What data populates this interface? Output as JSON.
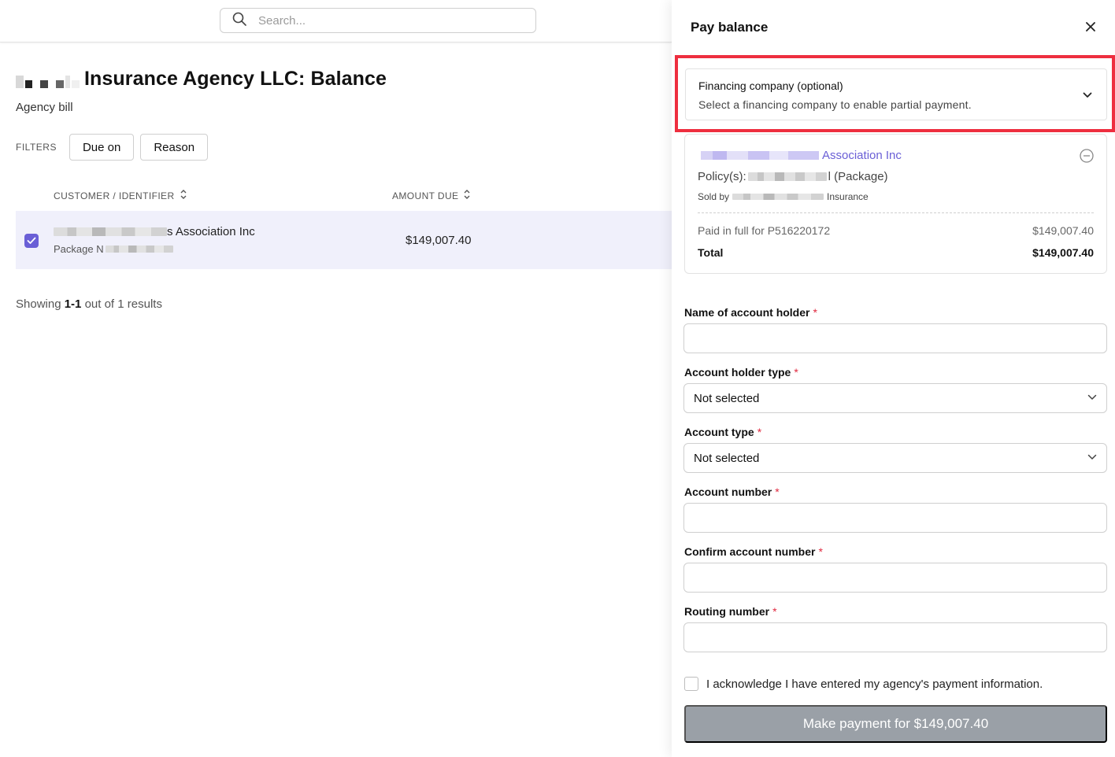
{
  "search": {
    "placeholder": "Search..."
  },
  "page": {
    "title": "Insurance Agency LLC: Balance",
    "subtitle": "Agency bill"
  },
  "filters": {
    "label": "FILTERS",
    "buttons": [
      "Due on",
      "Reason"
    ]
  },
  "table": {
    "columns": [
      "CUSTOMER / IDENTIFIER",
      "AMOUNT DUE"
    ],
    "rows": [
      {
        "customer_suffix": "s Association Inc",
        "identifier_prefix": "Package N",
        "amount": "$149,007.40",
        "selected": true
      }
    ]
  },
  "pagination": {
    "prefix": "Showing ",
    "range": "1-1",
    "suffix": " out of 1 results"
  },
  "panel": {
    "title": "Pay balance",
    "financing": {
      "title": "Financing company (optional)",
      "subtitle": "Select a financing company to enable partial payment."
    },
    "summary": {
      "name": "Association Inc",
      "policy_label": "Policy(s):",
      "policy_suffix": "l (Package)",
      "sold_by_label": "Sold by",
      "sold_by_suffix": "Insurance",
      "paid_label": "Paid in full for P516220172",
      "paid_amount": "$149,007.40",
      "total_label": "Total",
      "total_amount": "$149,007.40"
    },
    "fields": {
      "account_holder_name": "Name of account holder",
      "account_holder_type": "Account holder type",
      "account_holder_type_value": "Not selected",
      "account_type": "Account type",
      "account_type_value": "Not selected",
      "account_number": "Account number",
      "confirm_account_number": "Confirm account number",
      "routing_number": "Routing number",
      "required_mark": "*"
    },
    "acknowledgement": "I acknowledge I have entered my agency's payment information.",
    "pay_button": "Make payment for $149,007.40"
  },
  "colors": {
    "accent": "#6a5fd6",
    "highlight": "#ee2e3f",
    "required": "#e0293f",
    "disabled_button": "#9aa0a7"
  }
}
